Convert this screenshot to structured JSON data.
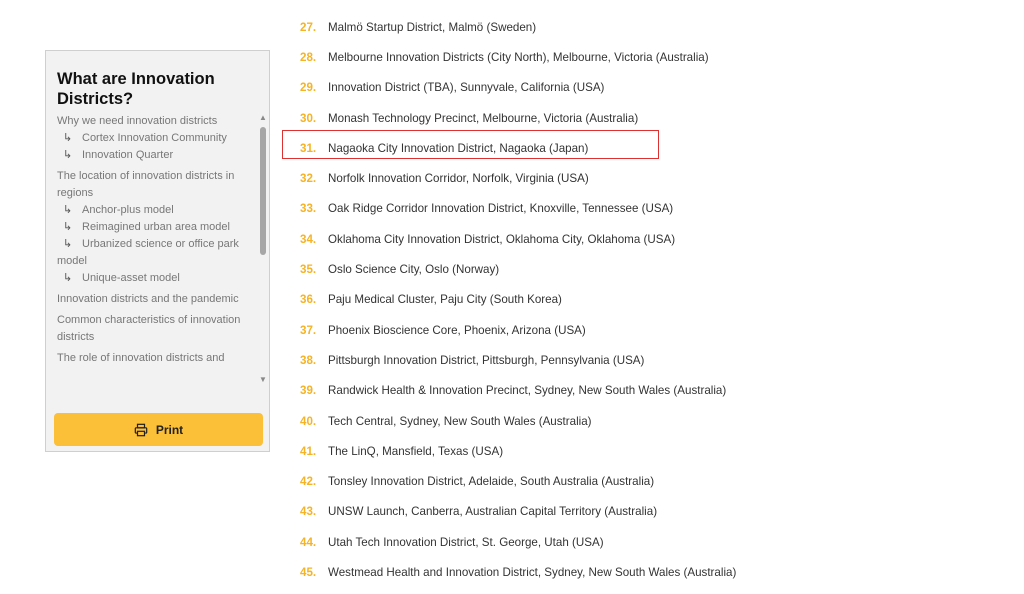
{
  "toc": {
    "title": "What are Innovation Districts?",
    "items": [
      {
        "label": "Why we need innovation districts",
        "level": 1
      },
      {
        "label": "Cortex Innovation Community",
        "level": 2
      },
      {
        "label": "Innovation Quarter",
        "level": 2
      },
      {
        "label": "The location of innovation districts in regions",
        "level": 1
      },
      {
        "label": "Anchor-plus model",
        "level": 2
      },
      {
        "label": "Reimagined urban area model",
        "level": 2
      },
      {
        "label": "Urbanized science or office park model",
        "level": 2
      },
      {
        "label": "Unique-asset model",
        "level": 2
      },
      {
        "label": "Innovation districts and the pandemic",
        "level": 1
      },
      {
        "label": "Common characteristics of innovation districts",
        "level": 1
      },
      {
        "label": "The role of innovation districts and",
        "level": 1
      }
    ],
    "sub_arrow": "↳",
    "scroll_up": "▲",
    "scroll_down": "▼",
    "print_label": "Print",
    "print_icon": "printer-icon",
    "accent_color": "#fcbf38"
  },
  "list": {
    "number_color": "#f5b326",
    "highlight_color": "#e03131",
    "highlighted_number": "31.",
    "entries": [
      {
        "num": "27.",
        "text": "Malmö Startup District, Malmö (Sweden)"
      },
      {
        "num": "28.",
        "text": "Melbourne Innovation Districts (City North), Melbourne, Victoria (Australia)"
      },
      {
        "num": "29.",
        "text": "Innovation District (TBA), Sunnyvale, California (USA)"
      },
      {
        "num": "30.",
        "text": "Monash Technology Precinct, Melbourne, Victoria (Australia)"
      },
      {
        "num": "31.",
        "text": "Nagaoka City Innovation District, Nagaoka (Japan)"
      },
      {
        "num": "32.",
        "text": "Norfolk Innovation Corridor, Norfolk, Virginia (USA)"
      },
      {
        "num": "33.",
        "text": "Oak Ridge Corridor Innovation District, Knoxville, Tennessee (USA)"
      },
      {
        "num": "34.",
        "text": "Oklahoma City Innovation District, Oklahoma City, Oklahoma (USA)"
      },
      {
        "num": "35.",
        "text": "Oslo Science City, Oslo (Norway)"
      },
      {
        "num": "36.",
        "text": "Paju Medical Cluster, Paju City (South Korea)"
      },
      {
        "num": "37.",
        "text": "Phoenix Bioscience Core, Phoenix, Arizona (USA)"
      },
      {
        "num": "38.",
        "text": "Pittsburgh Innovation District, Pittsburgh, Pennsylvania (USA)"
      },
      {
        "num": "39.",
        "text": "Randwick Health & Innovation Precinct, Sydney, New South Wales (Australia)"
      },
      {
        "num": "40.",
        "text": "Tech Central, Sydney, New South Wales (Australia)"
      },
      {
        "num": "41.",
        "text": "The LinQ, Mansfield, Texas (USA)"
      },
      {
        "num": "42.",
        "text": "Tonsley Innovation District, Adelaide, South Australia (Australia)"
      },
      {
        "num": "43.",
        "text": "UNSW Launch, Canberra, Australian Capital Territory (Australia)"
      },
      {
        "num": "44.",
        "text": "Utah Tech Innovation District, St. George, Utah (USA)"
      },
      {
        "num": "45.",
        "text": "Westmead Health and Innovation District, Sydney, New South Wales (Australia)"
      }
    ]
  }
}
